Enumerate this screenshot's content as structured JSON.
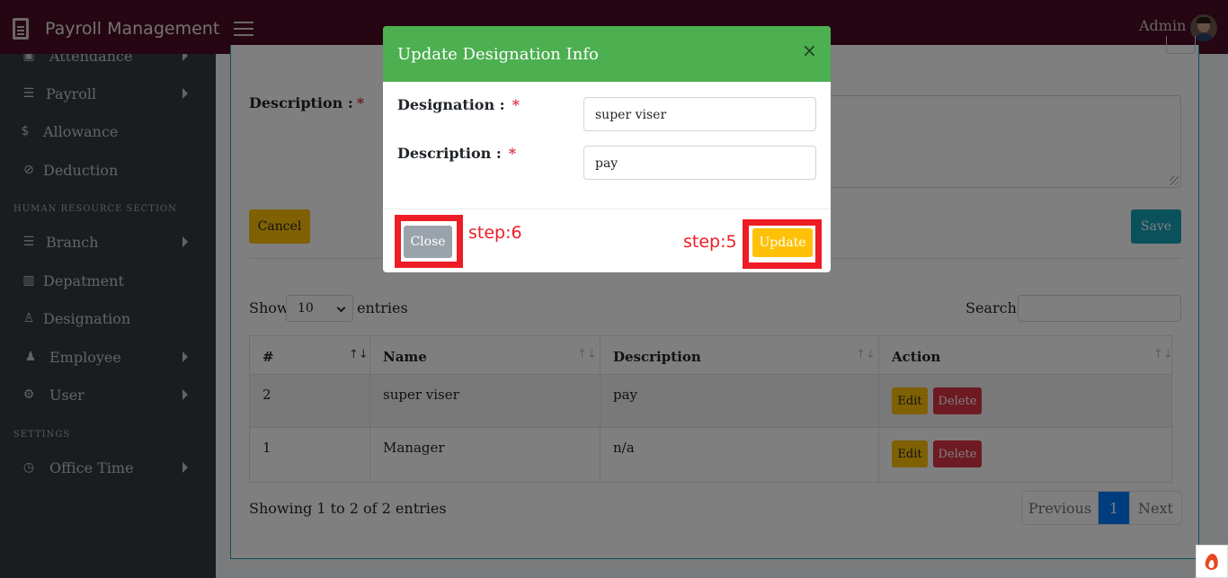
{
  "app": {
    "title": "Payroll Management",
    "user": "Admin"
  },
  "sidebar": {
    "items": [
      {
        "label": "Attendance",
        "icon": "attendance-icon",
        "has_caret": true
      },
      {
        "label": "Payroll",
        "icon": "list-icon",
        "has_caret": true
      },
      {
        "label": "Allowance",
        "icon": "dollar-icon",
        "has_caret": false
      },
      {
        "label": "Deduction",
        "icon": "no-dollar-icon",
        "has_caret": false
      },
      {
        "label": "Branch",
        "icon": "list-icon",
        "has_caret": true
      },
      {
        "label": "Depatment",
        "icon": "columns-icon",
        "has_caret": false
      },
      {
        "label": "Designation",
        "icon": "user-icon",
        "has_caret": false
      },
      {
        "label": "Employee",
        "icon": "user-tie-icon",
        "has_caret": true
      },
      {
        "label": "User",
        "icon": "user-cog-icon",
        "has_caret": true
      },
      {
        "label": "Office Time",
        "icon": "user-clock-icon",
        "has_caret": true
      }
    ],
    "sections": {
      "hr": "HUMAN RESOURCE SECTION",
      "settings": "SETTINGS"
    }
  },
  "form": {
    "description_label": "Description :",
    "required_mark": "*",
    "cancel_label": "Cancel",
    "save_label": "Save"
  },
  "table_controls": {
    "show_label": "Show",
    "page_size": "10",
    "entries_label": "entries",
    "search_label": "Search:",
    "search_value": ""
  },
  "table": {
    "columns": [
      "#",
      "Name",
      "Description",
      "Action"
    ],
    "rows": [
      {
        "id": "2",
        "name": "super viser",
        "description": "pay"
      },
      {
        "id": "1",
        "name": "Manager",
        "description": "n/a"
      }
    ],
    "edit_label": "Edit",
    "delete_label": "Delete",
    "info": "Showing 1 to 2 of 2 entries",
    "pagination": {
      "previous": "Previous",
      "current": "1",
      "next": "Next"
    }
  },
  "modal": {
    "title": "Update Designation Info",
    "close_symbol": "×",
    "designation_label": "Designation :",
    "designation_value": "super viser",
    "description_label": "Description :",
    "description_value": "pay",
    "required_mark": "*",
    "close_button": "Close",
    "update_button": "Update",
    "header_color": "#4caf50"
  },
  "annotations": {
    "close_step": "step:6",
    "update_step": "step:5",
    "color": "#ee1c25"
  }
}
